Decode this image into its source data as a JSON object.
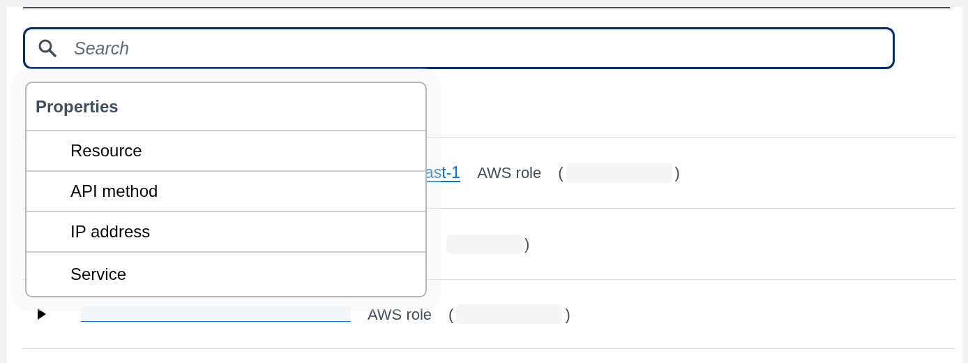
{
  "search": {
    "placeholder": "Search"
  },
  "dropdown": {
    "heading": "Properties",
    "items": [
      {
        "label": "Resource"
      },
      {
        "label": "API method"
      },
      {
        "label": "IP address"
      },
      {
        "label": "Service"
      }
    ]
  },
  "rows": [
    {
      "kind": "role",
      "expandable": false,
      "link": "ast-1",
      "role_label": "AWS role",
      "open_paren": "(",
      "close_paren": ")"
    },
    {
      "kind": "partial",
      "expandable": false,
      "close_paren": ")"
    },
    {
      "kind": "role",
      "expandable": true,
      "link": "",
      "role_label": "AWS role",
      "open_paren": "(",
      "close_paren": ")"
    }
  ]
}
